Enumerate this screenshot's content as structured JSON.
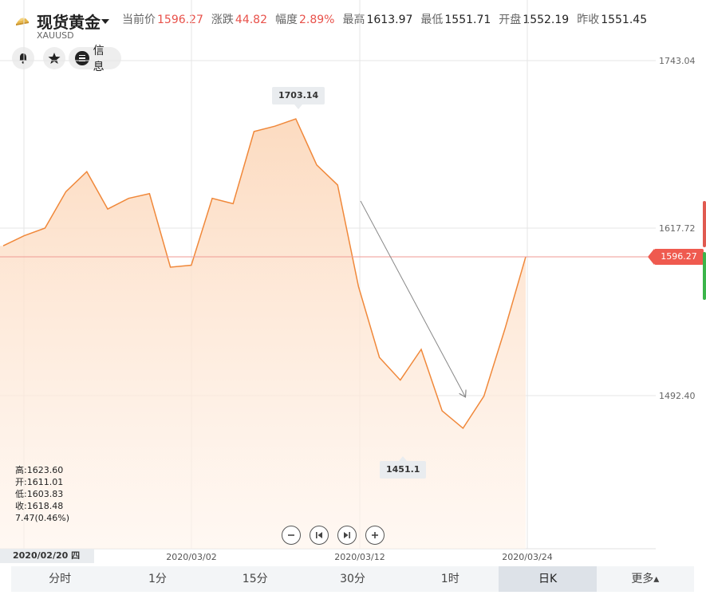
{
  "header": {
    "title": "现货黄金",
    "code": "XAUUSD",
    "quotes": [
      {
        "label": "当前价",
        "value": "1596.27",
        "up": true
      },
      {
        "label": "涨跌",
        "value": "44.82",
        "up": true
      },
      {
        "label": "幅度",
        "value": "2.89%",
        "up": true
      },
      {
        "label": "最高",
        "value": "1613.97",
        "up": false
      },
      {
        "label": "最低",
        "value": "1551.71",
        "up": false
      },
      {
        "label": "开盘",
        "value": "1552.19",
        "up": false
      },
      {
        "label": "昨收",
        "value": "1551.45",
        "up": false
      }
    ]
  },
  "toolbar": {
    "info_label": "信息",
    "icons": [
      "bell-icon",
      "star-icon",
      "list-icon"
    ]
  },
  "chart_data": {
    "type": "area",
    "y_ticks": [
      "1743.04",
      "1617.72",
      "1492.40"
    ],
    "x_ticks": [
      "2020/03/02",
      "2020/03/12",
      "2020/03/24"
    ],
    "current_price": "1596.27",
    "high_label": "1703.14",
    "low_label": "1451.1",
    "values": [
      1604.5,
      1612,
      1617.7,
      1645,
      1660,
      1632,
      1640,
      1643.5,
      1588.5,
      1590,
      1640,
      1636,
      1690,
      1694,
      1699.5,
      1665,
      1650,
      1574,
      1521,
      1504,
      1527,
      1481,
      1468,
      1492,
      1542,
      1596.3
    ],
    "colors": {
      "line": "#f0883a",
      "area": "#fde3d0",
      "current": "#ef5a4f"
    }
  },
  "ohlc": {
    "high": "高:1623.60",
    "open": "开:1611.01",
    "low": "低:1603.83",
    "close": "收:1618.48",
    "change": "7.47(0.46%)"
  },
  "selected_date": "2020/02/20 四",
  "periods": [
    {
      "label": "分时",
      "active": false
    },
    {
      "label": "1分",
      "active": false
    },
    {
      "label": "15分",
      "active": false
    },
    {
      "label": "30分",
      "active": false
    },
    {
      "label": "1时",
      "active": false
    },
    {
      "label": "日K",
      "active": true
    },
    {
      "label": "更多▴",
      "active": false
    }
  ]
}
